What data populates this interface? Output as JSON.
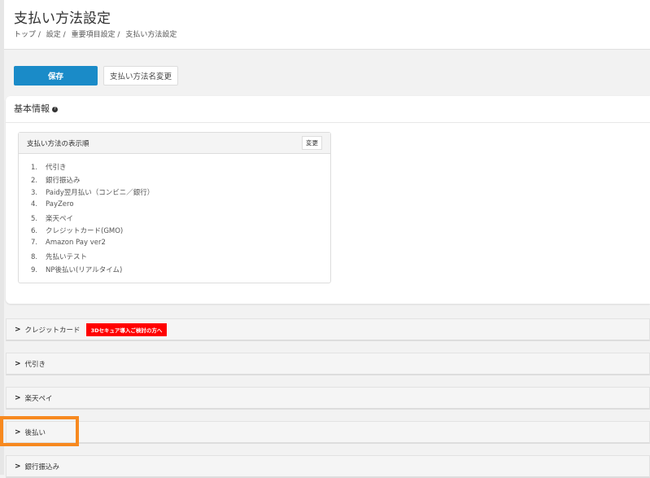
{
  "header": {
    "title": "支払い方法設定",
    "breadcrumb": [
      "トップ /",
      "設定 /",
      "重要項目設定 /",
      "支払い方法設定"
    ]
  },
  "toolbar": {
    "save_label": "保存",
    "rename_label": "支払い方法名変更"
  },
  "basic": {
    "title": "基本情報",
    "help": "?",
    "order_box": {
      "title": "支払い方法の表示順",
      "change_label": "変更",
      "items": [
        {
          "n": "1.",
          "label": "代引き"
        },
        {
          "n": "2.",
          "label": "銀行振込み"
        },
        {
          "n": "3.",
          "label": "Paidy翌月払い（コンビニ／銀行）"
        },
        {
          "n": "4.",
          "label": "PayZero"
        },
        {
          "n": "5.",
          "label": "楽天ペイ"
        },
        {
          "n": "6.",
          "label": "クレジットカード(GMO)"
        },
        {
          "n": "7.",
          "label": "Amazon Pay ver2"
        },
        {
          "n": "8.",
          "label": "先払いテスト"
        },
        {
          "n": "9.",
          "label": "NP後払い(リアルタイム)"
        }
      ]
    }
  },
  "sections": [
    {
      "label": "クレジットカード",
      "badge": "3Dセキュア導入ご検討の方へ"
    },
    {
      "label": "代引き"
    },
    {
      "label": "楽天ペイ"
    },
    {
      "label": "後払い"
    },
    {
      "label": "銀行振込み"
    }
  ],
  "colors": {
    "primary": "#1a8bc8",
    "badge": "#ff0000",
    "highlight": "#f7891f"
  }
}
